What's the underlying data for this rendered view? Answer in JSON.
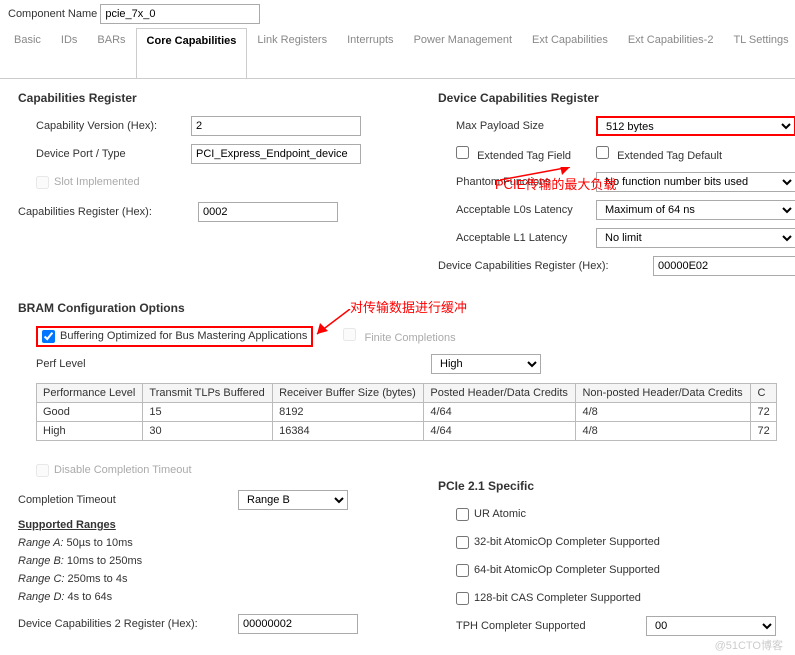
{
  "header": {
    "component_name_label": "Component Name",
    "component_name_value": "pcie_7x_0"
  },
  "tabs": [
    "Basic",
    "IDs",
    "BARs",
    "Core Capabilities",
    "Link Registers",
    "Interrupts",
    "Power Management",
    "Ext Capabilities",
    "Ext Capabilities-2",
    "TL Settings"
  ],
  "capabilities": {
    "title": "Capabilities Register",
    "cap_version_label": "Capability Version (Hex):",
    "cap_version_value": "2",
    "device_port_label": "Device Port / Type",
    "device_port_value": "PCI_Express_Endpoint_device",
    "slot_impl_label": "Slot Implemented",
    "cap_reg_label": "Capabilities Register (Hex):",
    "cap_reg_value": "0002"
  },
  "device_caps": {
    "title": "Device Capabilities Register",
    "max_payload_label": "Max Payload Size",
    "max_payload_value": "512 bytes",
    "ext_tag_field_label": "Extended Tag Field",
    "ext_tag_default_label": "Extended Tag Default",
    "phantom_label": "Phantom Functions",
    "phantom_value": "No function number bits used",
    "l0s_label": "Acceptable L0s Latency",
    "l0s_value": "Maximum of 64 ns",
    "l1_label": "Acceptable L1 Latency",
    "l1_value": "No limit",
    "dev_cap_reg_label": "Device Capabilities Register (Hex):",
    "dev_cap_reg_value": "00000E02"
  },
  "annotations": {
    "payload": "PCIE传输的最大负载",
    "buffer": "对传输数据进行缓冲"
  },
  "bram": {
    "title": "BRAM Configuration Options",
    "buffering_label": "Buffering Optimized for Bus Mastering Applications",
    "finite_label": "Finite Completions",
    "perf_level_label": "Perf Level",
    "perf_level_value": "High",
    "table": {
      "headers": [
        "Performance Level",
        "Transmit TLPs Buffered",
        "Receiver Buffer Size (bytes)",
        "Posted Header/Data Credits",
        "Non-posted Header/Data Credits",
        "C"
      ],
      "rows": [
        {
          "perf": "Good",
          "tlp": "15",
          "recv": "8192",
          "posted": "4/64",
          "nonposted": "4/8",
          "c": "72"
        },
        {
          "perf": "High",
          "tlp": "30",
          "recv": "16384",
          "posted": "4/64",
          "nonposted": "4/8",
          "c": "72"
        }
      ]
    }
  },
  "completion": {
    "disable_label": "Disable Completion Timeout",
    "timeout_label": "Completion Timeout",
    "timeout_value": "Range B",
    "ranges_title": "Supported Ranges",
    "ranges": [
      {
        "name": "Range A:",
        "desc": " 50µs to 10ms"
      },
      {
        "name": "Range B:",
        "desc": " 10ms to 250ms"
      },
      {
        "name": "Range C:",
        "desc": " 250ms to 4s"
      },
      {
        "name": "Range D:",
        "desc": " 4s to 64s"
      }
    ],
    "dev_cap2_label": "Device Capabilities 2 Register (Hex):",
    "dev_cap2_value": "00000002"
  },
  "pcie21": {
    "title": "PCIe 2.1 Specific",
    "ur_atomic": "UR Atomic",
    "atomic32": "32-bit AtomicOp Completer Supported",
    "atomic64": "64-bit AtomicOp Completer Supported",
    "cas128": "128-bit CAS Completer Supported",
    "tph_label": "TPH Completer Supported",
    "tph_value": "00"
  },
  "watermark": "@51CTO博客"
}
